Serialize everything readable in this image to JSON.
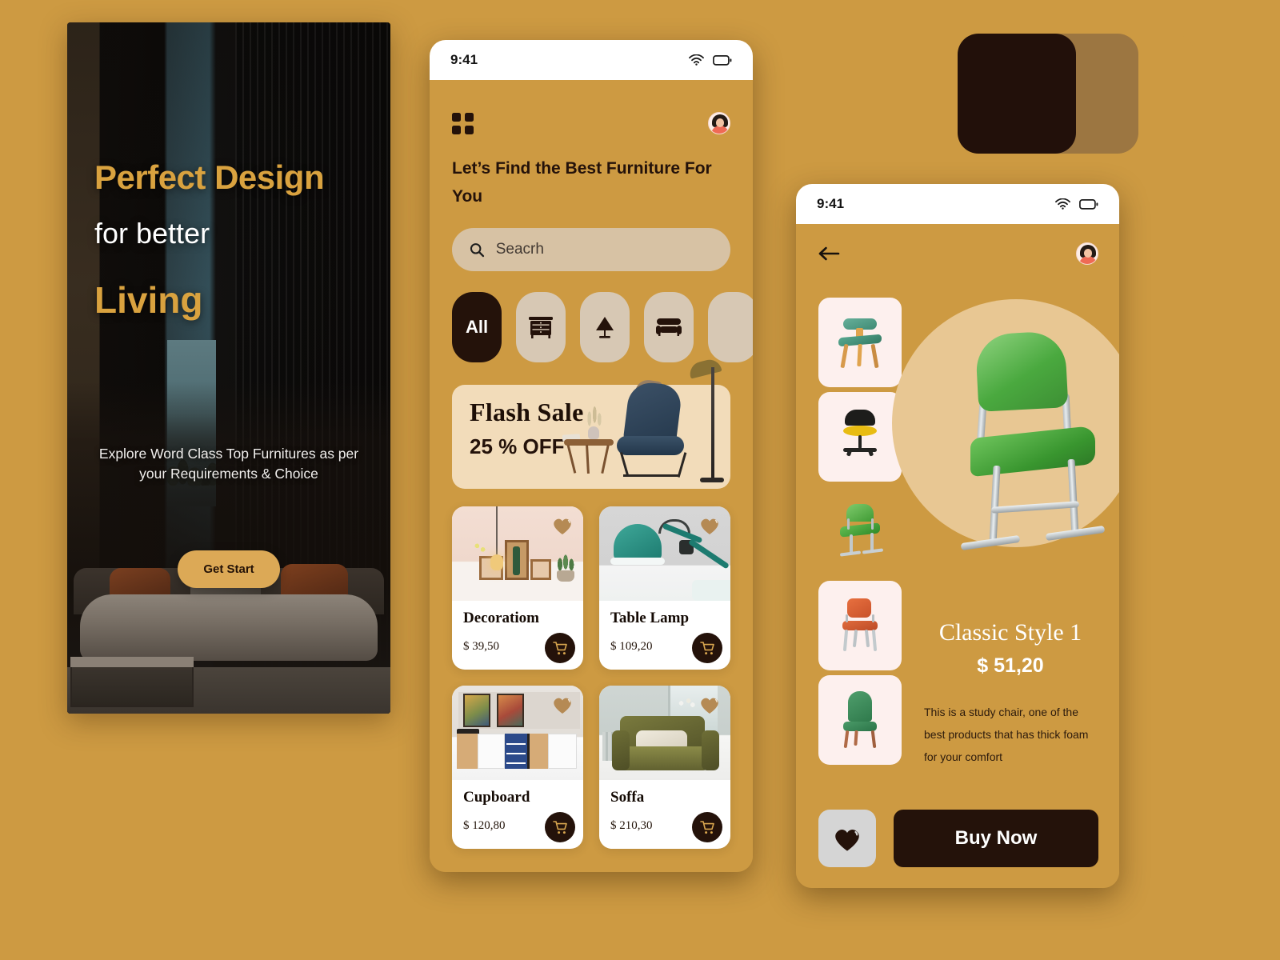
{
  "theme": {
    "background": "#cd9a42",
    "dark": "#24120a",
    "accent_gold": "#d9a23f",
    "card_cream": "#f2dcba",
    "search_tan": "#d7c2a4",
    "chip_tan": "#d7c8b4",
    "thumb_pink": "#fdf0ee",
    "circle_tan": "#e8c793"
  },
  "hero": {
    "title_line1": "Perfect Design",
    "title_line2": "for better",
    "title_line3": "Living",
    "subtitle": "Explore Word Class Top Furnitures as per your Requirements & Choice",
    "cta_label": "Get Start"
  },
  "home": {
    "status": {
      "time": "9:41",
      "wifi_icon": "wifi-icon",
      "battery_icon": "battery-icon"
    },
    "menu_icon": "grid-menu-icon",
    "avatar": "user-avatar",
    "heading": "Let’s Find the Best Furniture For You",
    "search": {
      "placeholder": "Seacrh",
      "value": "",
      "icon": "search-icon"
    },
    "categories": [
      {
        "label": "All",
        "icon": "all-label",
        "active": true
      },
      {
        "label": "",
        "icon": "dresser-icon",
        "active": false
      },
      {
        "label": "",
        "icon": "lamp-icon",
        "active": false
      },
      {
        "label": "",
        "icon": "sofa-icon",
        "active": false
      },
      {
        "label": "",
        "icon": "more-icon",
        "active": false
      }
    ],
    "promo": {
      "title": "Flash Sale",
      "subtitle": "25 % OFF",
      "art": "chair-table-lamp-illustration"
    },
    "products": [
      {
        "name": "Decoratiom",
        "price": "$ 39,50",
        "fav_icon": "heart-icon",
        "cart_icon": "cart-icon",
        "image": "shelf-decoration-photo"
      },
      {
        "name": "Table Lamp",
        "price": "$ 109,20",
        "fav_icon": "heart-icon",
        "cart_icon": "cart-icon",
        "image": "teal-desk-lamp-photo"
      },
      {
        "name": "Cupboard",
        "price": "$ 120,80",
        "fav_icon": "heart-icon",
        "cart_icon": "cart-icon",
        "image": "cupboard-shelf-photo"
      },
      {
        "name": "Soffa",
        "price": "$ 210,30",
        "fav_icon": "heart-icon",
        "cart_icon": "cart-icon",
        "image": "olive-armchair-photo"
      }
    ]
  },
  "detail": {
    "status": {
      "time": "9:41",
      "wifi_icon": "wifi-icon",
      "battery_icon": "battery-icon"
    },
    "back_icon": "back-arrow-icon",
    "avatar": "user-avatar",
    "thumbnails": [
      {
        "name": "green-wood-chair",
        "selected": false
      },
      {
        "name": "black-yellow-office-chair",
        "selected": false
      },
      {
        "name": "green-school-chair",
        "selected": true
      },
      {
        "name": "orange-metal-chair",
        "selected": false
      },
      {
        "name": "green-dining-chair",
        "selected": false
      }
    ],
    "product": {
      "title": "Classic Style 1",
      "price": "$ 51,20",
      "description": "This is a study chair, one of the best products that has thick foam for your comfort",
      "image": "green-school-chair-large"
    },
    "fav_icon": "heart-icon",
    "buy_label": "Buy Now"
  },
  "swatch": {
    "colors": [
      "#22100a",
      "#9c7641",
      "#cd9a42"
    ]
  }
}
